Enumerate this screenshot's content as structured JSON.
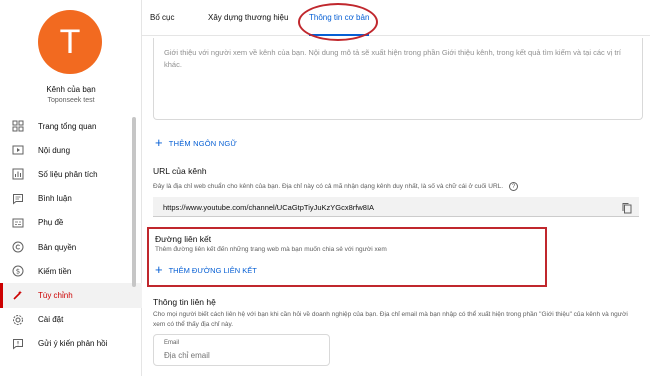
{
  "sidebar": {
    "avatar_letter": "T",
    "channel_title": "Kênh của bạn",
    "channel_handle": "Toponseek test",
    "items": [
      {
        "label": "Trang tổng quan",
        "icon": "dashboard-icon"
      },
      {
        "label": "Nội dung",
        "icon": "content-icon"
      },
      {
        "label": "Số liệu phân tích",
        "icon": "analytics-icon"
      },
      {
        "label": "Bình luận",
        "icon": "comments-icon"
      },
      {
        "label": "Phụ đề",
        "icon": "subtitles-icon"
      },
      {
        "label": "Bản quyền",
        "icon": "copyright-icon"
      },
      {
        "label": "Kiếm tiền",
        "icon": "monetization-icon"
      },
      {
        "label": "Tùy chỉnh",
        "icon": "customization-icon"
      },
      {
        "label": "Cài đặt",
        "icon": "settings-icon"
      },
      {
        "label": "Gửi ý kiến phản hồi",
        "icon": "feedback-icon"
      }
    ],
    "active_item": "Tùy chỉnh"
  },
  "tabs": [
    {
      "label": "Bố cục"
    },
    {
      "label": "Xây dựng thương hiệu"
    },
    {
      "label": "Thông tin cơ bản"
    }
  ],
  "active_tab": "Thông tin cơ bản",
  "description": {
    "placeholder": "Giới thiệu với người xem về kênh của bạn. Nội dung mô tả sẽ xuất hiện trong phần Giới thiệu kênh, trong kết quả tìm kiếm và tại các vị trí khác."
  },
  "add_language_label": "THÊM NGÔN NGỮ",
  "channel_url": {
    "title": "URL của kênh",
    "help": "Đây là địa chỉ web chuẩn cho kênh của bạn. Địa chỉ này có cả mã nhận dạng kênh duy nhất, là số và chữ cái ở cuối URL.",
    "value": "https://www.youtube.com/channel/UCaGtpTiyJuKzYGcx8rfw8IA"
  },
  "links": {
    "title": "Đường liên kết",
    "help": "Thêm đường liên kết đến những trang web mà bạn muốn chia sẻ với người xem",
    "add_label": "THÊM ĐƯỜNG LIÊN KẾT"
  },
  "contact": {
    "title": "Thông tin liên hệ",
    "help": "Cho mọi người biết cách liên hệ với bạn khi cần hỏi về doanh nghiệp của bạn. Địa chỉ email mà bạn nhập có thể xuất hiện trong phần \"Giới thiệu\" của kênh và người xem có thể thấy địa chỉ này.",
    "email_label": "Email",
    "email_placeholder": "Địa chỉ email"
  },
  "colors": {
    "accent": "#065fd4",
    "highlight": "#c0272d",
    "avatar": "#f26a20"
  }
}
